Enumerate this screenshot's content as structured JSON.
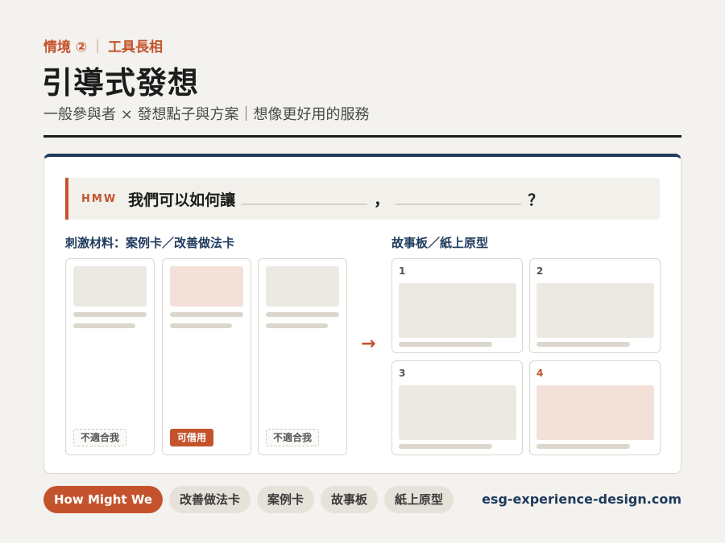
{
  "eyebrow": {
    "scenario": "情境 ②",
    "separator": "|",
    "topic": "工具長相"
  },
  "title": "引導式發想",
  "subtitle": "一般參與者 × 發想點子與方案｜想像更好用的服務",
  "hmw": {
    "tag": "HMW",
    "prefix": "我們可以如何讓",
    "comma": "，",
    "question": "？"
  },
  "materials": {
    "label": "刺激材料：案例卡／改善做法卡",
    "cards": [
      {
        "badge": "不適合我",
        "highlight": false
      },
      {
        "badge": "可借用",
        "highlight": true
      },
      {
        "badge": "不適合我",
        "highlight": false
      }
    ]
  },
  "arrow": "→",
  "storyboard": {
    "label": "故事板／紙上原型",
    "panels": [
      {
        "number": "1",
        "highlight": false
      },
      {
        "number": "2",
        "highlight": false
      },
      {
        "number": "3",
        "highlight": false
      },
      {
        "number": "4",
        "highlight": true
      }
    ]
  },
  "tags": [
    "How Might We",
    "改善做法卡",
    "案例卡",
    "故事板",
    "紙上原型"
  ],
  "site": "esg-experience-design.com",
  "colors": {
    "accent": "#c4532d",
    "navy": "#1e3a5c",
    "background": "#f4f2ee"
  }
}
